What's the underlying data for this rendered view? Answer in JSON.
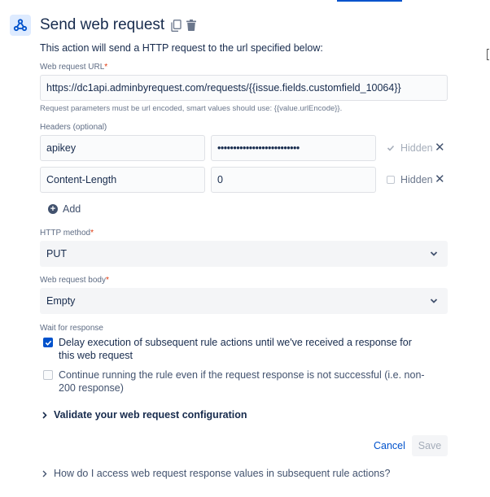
{
  "header": {
    "title": "Send web request",
    "description": "This action will send a HTTP request to the url specified below:"
  },
  "url": {
    "label": "Web request URL",
    "required_marker": "*",
    "value": "https://dc1api.adminbyrequest.com/requests/{{issue.fields.customfield_10064}}",
    "help": "Request parameters must be url encoded, smart values should use: {{value.urlEncode}}."
  },
  "headers": {
    "label": "Headers (optional)",
    "rows": [
      {
        "name": "apikey",
        "value": "••••••••••••••••••••••••••",
        "hidden_label": "Hidden",
        "hidden_checked": true
      },
      {
        "name": "Content-Length",
        "value": "0",
        "hidden_label": "Hidden",
        "hidden_checked": false
      }
    ],
    "add_label": "Add"
  },
  "method": {
    "label": "HTTP method",
    "required_marker": "*",
    "value": "PUT"
  },
  "body": {
    "label": "Web request body",
    "required_marker": "*",
    "value": "Empty"
  },
  "wait": {
    "label": "Wait for response",
    "delay_text": "Delay execution of subsequent rule actions until we've received a response for this web request",
    "delay_checked": true,
    "continue_text": "Continue running the rule even if the request response is not successful (i.e. non-200 response)",
    "continue_checked": false
  },
  "validate": {
    "label": "Validate your web request configuration"
  },
  "footer": {
    "cancel_label": "Cancel",
    "save_label": "Save",
    "faq_label": "How do I access web request response values in subsequent rule actions?"
  },
  "colors": {
    "accent": "#0052cc",
    "text": "#172b4d",
    "muted": "#6b778c",
    "required": "#de350b"
  }
}
